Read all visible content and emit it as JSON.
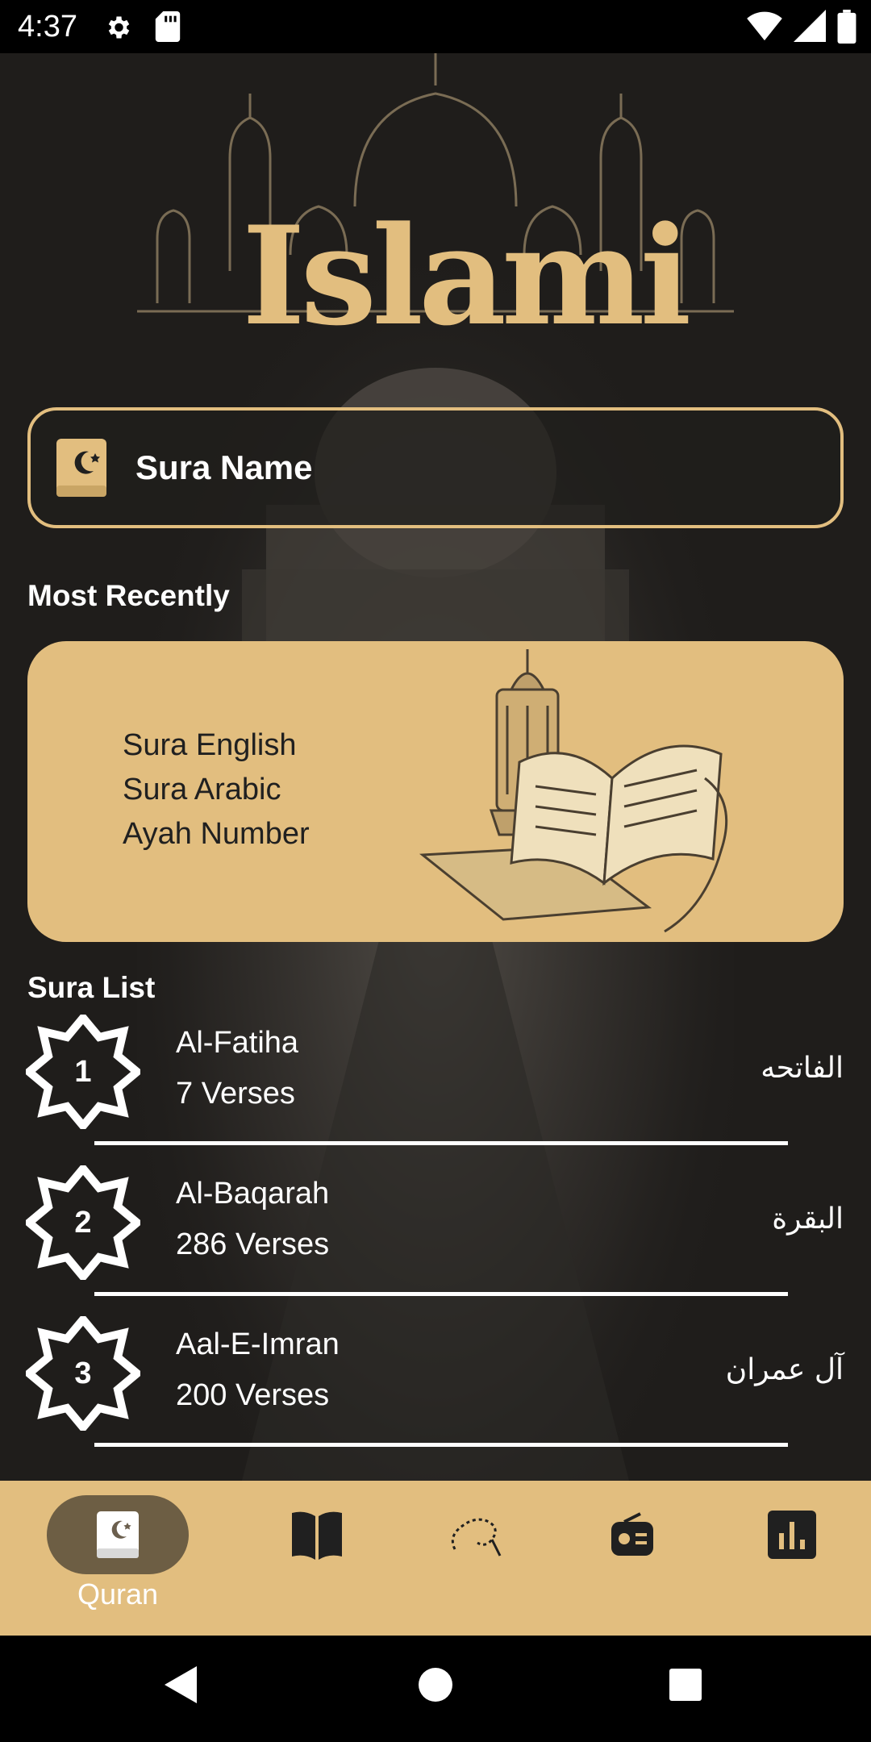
{
  "status_bar": {
    "time": "4:37",
    "icons": [
      "gear-icon",
      "sd-card-icon",
      "wifi-icon",
      "signal-icon",
      "battery-icon"
    ]
  },
  "header": {
    "logo_text": "Islami"
  },
  "search": {
    "placeholder": "Sura Name",
    "icon": "quran-book-icon"
  },
  "most_recently": {
    "title": "Most Recently",
    "sura_english": "Sura English",
    "sura_arabic": "Sura Arabic",
    "ayah_number": "Ayah Number"
  },
  "sura_list": {
    "title": "Sura List",
    "items": [
      {
        "number": "1",
        "name": "Al-Fatiha",
        "verses": "7 Verses",
        "arabic": "الفاتحه"
      },
      {
        "number": "2",
        "name": "Al-Baqarah",
        "verses": "286 Verses",
        "arabic": "البقرة"
      },
      {
        "number": "3",
        "name": "Aal-E-Imran",
        "verses": "200 Verses",
        "arabic": "آل عمران"
      }
    ]
  },
  "bottom_nav": {
    "items": [
      {
        "label": "Quran",
        "icon": "quran-icon",
        "active": true
      },
      {
        "label": "",
        "icon": "hadith-book-icon",
        "active": false
      },
      {
        "label": "",
        "icon": "sebha-icon",
        "active": false
      },
      {
        "label": "",
        "icon": "radio-icon",
        "active": false
      },
      {
        "label": "",
        "icon": "time-chart-icon",
        "active": false
      }
    ]
  },
  "colors": {
    "accent": "#e2be7f",
    "background": "#1f1d1b",
    "text": "#ffffff"
  }
}
